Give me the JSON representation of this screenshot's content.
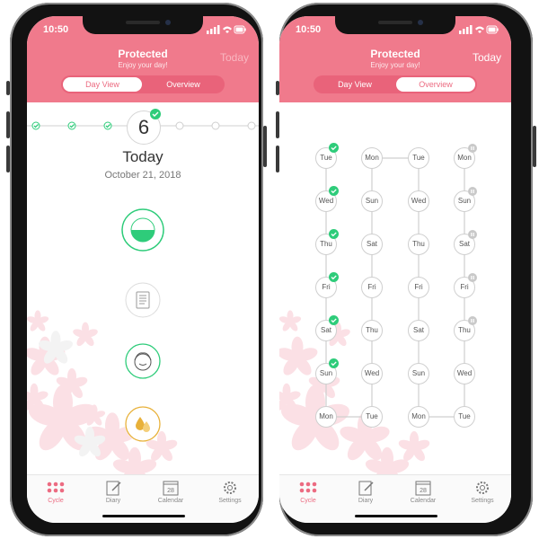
{
  "left": {
    "status_time": "10:50",
    "title": "Protected",
    "subtitle": "Enjoy your day!",
    "today_button": "Today",
    "segment": [
      "Day View",
      "Overview"
    ],
    "day_number": "6",
    "today_label": "Today",
    "date": "October 21, 2018"
  },
  "right": {
    "status_time": "10:50",
    "title": "Protected",
    "subtitle": "Enjoy your day!",
    "today_button": "Today",
    "segment": [
      "Day View",
      "Overview"
    ],
    "columns": [
      [
        "Tue",
        "Wed",
        "Thu",
        "Fri",
        "Sat",
        "Sun",
        "Mon"
      ],
      [
        "Mon",
        "Sun",
        "Sat",
        "Fri",
        "Thu",
        "Wed",
        "Tue"
      ],
      [
        "Tue",
        "Wed",
        "Thu",
        "Fri",
        "Sat",
        "Sun",
        "Mon"
      ],
      [
        "Mon",
        "Sun",
        "Sat",
        "Fri",
        "Thu",
        "Wed",
        "Tue"
      ]
    ]
  },
  "tabs": {
    "cycle": "Cycle",
    "diary": "Diary",
    "calendar": "Calendar",
    "calendar_day": "28",
    "settings": "Settings"
  },
  "colors": {
    "accent": "#f07a8c",
    "accent_dark": "#e9637a",
    "check": "#2ecc7a",
    "pill": "#e8b13a"
  }
}
